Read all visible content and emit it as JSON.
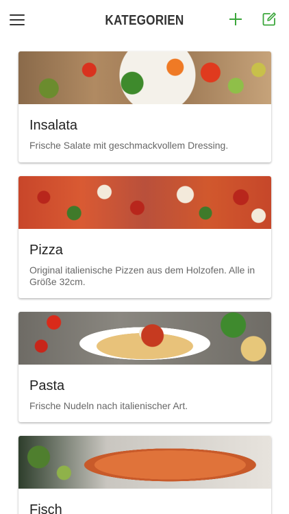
{
  "header": {
    "title": "KATEGORIEN",
    "menu_icon": "hamburger-menu-icon",
    "add_icon": "plus-icon",
    "edit_icon": "edit-square-icon",
    "accent_color": "#3aa63a"
  },
  "categories": [
    {
      "title": "Insalata",
      "description": "Frische Salate mit geschmackvollem Dressing."
    },
    {
      "title": "Pizza",
      "description": "Original italienische Pizzen aus dem Holzofen. Alle in Größe 32cm."
    },
    {
      "title": "Pasta",
      "description": "Frische Nudeln nach italienischer Art."
    },
    {
      "title": "Fisch",
      "description": ""
    }
  ]
}
